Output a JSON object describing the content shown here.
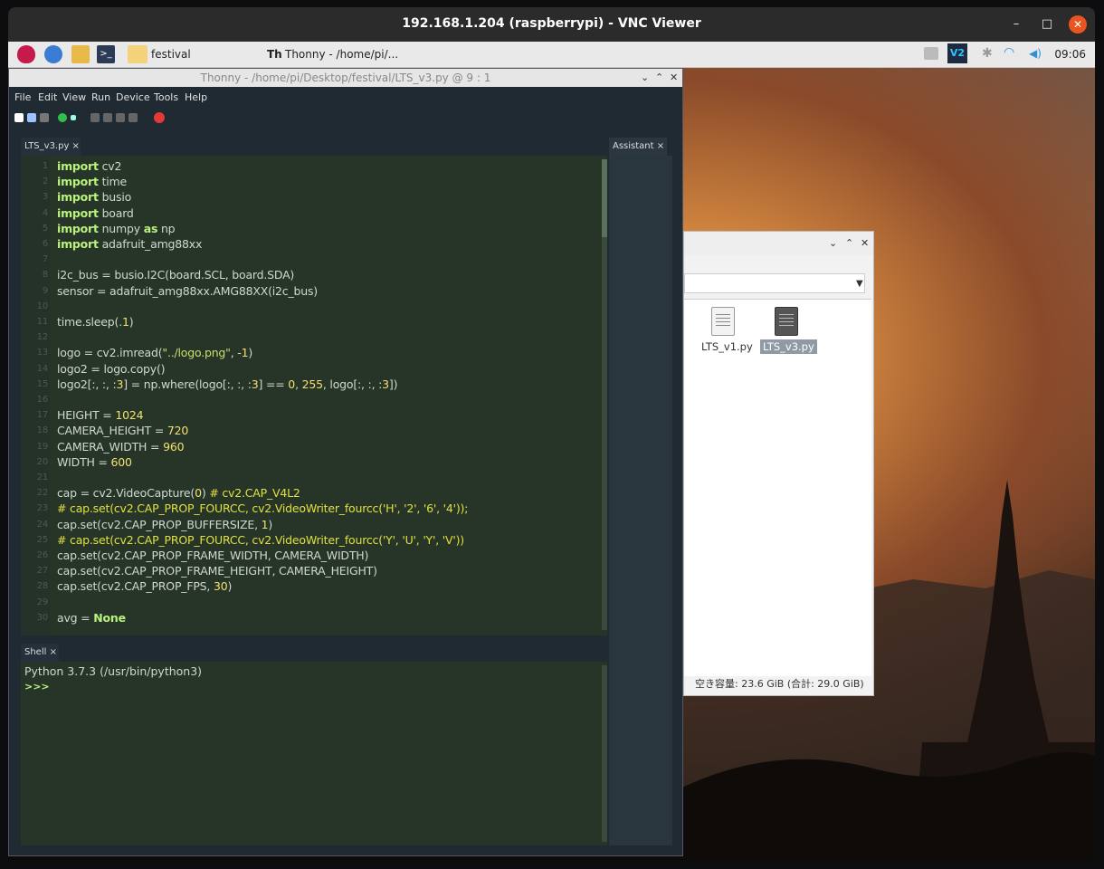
{
  "vnc": {
    "title": "192.168.1.204 (raspberrypi) - VNC Viewer",
    "minimize": "–",
    "maximize": "□",
    "close": "✕"
  },
  "taskbar": {
    "folder_label": "festival",
    "thonny_label": "Thonny  -  /home/pi/...",
    "clock": "09:06",
    "vnc_badge": "V2"
  },
  "thonny": {
    "title": "Thonny  -  /home/pi/Desktop/festival/LTS_v3.py  @  9 : 1",
    "controls": [
      "⌄",
      "⌃",
      "✕"
    ],
    "menu": [
      "File",
      "Edit",
      "View",
      "Run",
      "Device",
      "Tools",
      "Help"
    ],
    "editor_tab": "LTS_v3.py ×",
    "assistant_tab": "Assistant ×",
    "shell_tab": "Shell ×",
    "shell_line1": "Python 3.7.3 (/usr/bin/python3)",
    "shell_prompt": ">>>",
    "code_lines": [
      {
        "n": "1",
        "t": "import cv2"
      },
      {
        "n": "2",
        "t": "import time"
      },
      {
        "n": "3",
        "t": "import busio"
      },
      {
        "n": "4",
        "t": "import board"
      },
      {
        "n": "5",
        "t": "import numpy as np"
      },
      {
        "n": "6",
        "t": "import adafruit_amg88xx"
      },
      {
        "n": "7",
        "t": ""
      },
      {
        "n": "8",
        "t": "i2c_bus = busio.I2C(board.SCL, board.SDA)"
      },
      {
        "n": "9",
        "t": "sensor = adafruit_amg88xx.AMG88XX(i2c_bus)"
      },
      {
        "n": "10",
        "t": ""
      },
      {
        "n": "11",
        "t": "time.sleep(.1)"
      },
      {
        "n": "12",
        "t": ""
      },
      {
        "n": "13",
        "t": "logo = cv2.imread(\"../logo.png\", -1)"
      },
      {
        "n": "14",
        "t": "logo2 = logo.copy()"
      },
      {
        "n": "15",
        "t": "logo2[:, :, :3] = np.where(logo[:, :, :3] == 0, 255, logo[:, :, :3])"
      },
      {
        "n": "16",
        "t": ""
      },
      {
        "n": "17",
        "t": "HEIGHT = 1024"
      },
      {
        "n": "18",
        "t": "CAMERA_HEIGHT = 720"
      },
      {
        "n": "19",
        "t": "CAMERA_WIDTH = 960"
      },
      {
        "n": "20",
        "t": "WIDTH = 600"
      },
      {
        "n": "21",
        "t": ""
      },
      {
        "n": "22",
        "t": "cap = cv2.VideoCapture(0) # cv2.CAP_V4L2"
      },
      {
        "n": "23",
        "t": "# cap.set(cv2.CAP_PROP_FOURCC, cv2.VideoWriter_fourcc('H', '2', '6', '4'));"
      },
      {
        "n": "24",
        "t": "cap.set(cv2.CAP_PROP_BUFFERSIZE, 1)"
      },
      {
        "n": "25",
        "t": "# cap.set(cv2.CAP_PROP_FOURCC, cv2.VideoWriter_fourcc('Y', 'U', 'Y', 'V'))"
      },
      {
        "n": "26",
        "t": "cap.set(cv2.CAP_PROP_FRAME_WIDTH, CAMERA_WIDTH)"
      },
      {
        "n": "27",
        "t": "cap.set(cv2.CAP_PROP_FRAME_HEIGHT, CAMERA_HEIGHT)"
      },
      {
        "n": "28",
        "t": "cap.set(cv2.CAP_PROP_FPS, 30)"
      },
      {
        "n": "29",
        "t": ""
      },
      {
        "n": "30",
        "t": "avg = None"
      }
    ]
  },
  "filemgr": {
    "controls": [
      "⌄",
      "⌃",
      "✕"
    ],
    "files": [
      {
        "name": "LTS_v1.py",
        "selected": false
      },
      {
        "name": "LTS_v3.py",
        "selected": true
      }
    ],
    "status": "空き容量: 23.6 GiB (合計: 29.0 GiB)"
  },
  "colors": {
    "keyword": "#b9f27c",
    "string": "#c7e06a",
    "number": "#f2e06f",
    "comment": "#e0e040",
    "editor_bg": "#273529",
    "vnc_close": "#e95420"
  }
}
